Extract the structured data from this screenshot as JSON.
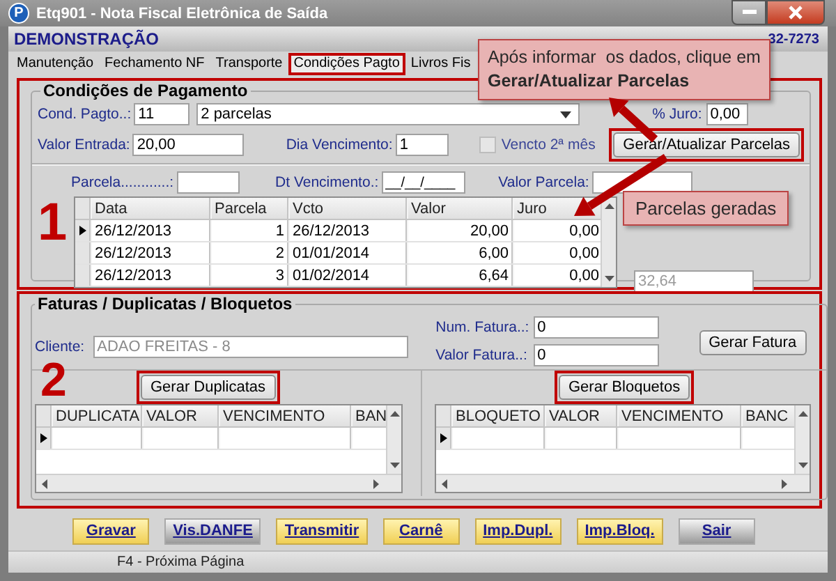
{
  "window": {
    "icon_letter": "P",
    "title": "Etq901 - Nota Fiscal Eletrônica de Saída"
  },
  "header": {
    "company": "DEMONSTRAÇÃO",
    "phone": "32-7273"
  },
  "tabs": [
    {
      "label": "Manutenção",
      "selected": false,
      "highlighted": false
    },
    {
      "label": "Fechamento NF",
      "selected": false,
      "highlighted": false
    },
    {
      "label": "Transporte",
      "selected": false,
      "highlighted": false
    },
    {
      "label": "Condições Pagto",
      "selected": true,
      "highlighted": true
    },
    {
      "label": "Livros Fis",
      "selected": false,
      "highlighted": false
    }
  ],
  "payment": {
    "highlighted": true,
    "marker": "1",
    "title": "Condições de Pagamento",
    "cond_label": "Cond. Pagto..:",
    "cond_code": "11",
    "cond_desc": "2 parcelas",
    "juro_label": "% Juro:",
    "juro": "0,00",
    "entrada_label": "Valor Entrada:",
    "entrada": "20,00",
    "dia_label": "Dia Vencimento:",
    "dia": "1",
    "vencto2": {
      "label": "Vencto 2ª mês",
      "checked": false,
      "disabled": true
    },
    "generate_button": {
      "label": "Gerar/Atualizar Parcelas",
      "highlighted": true
    },
    "parcela_label": "Parcela............:",
    "dt_label": "Dt Vencimento.:",
    "dt_value": "__/__/____",
    "valor_parcela_label": "Valor Parcela:",
    "table": {
      "columns": [
        {
          "label": "Data",
          "kind": "text"
        },
        {
          "label": "Parcela",
          "kind": "number"
        },
        {
          "label": "Vcto",
          "kind": "text"
        },
        {
          "label": "Valor",
          "kind": "number"
        },
        {
          "label": "Juro",
          "kind": "number"
        }
      ],
      "rows": [
        {
          "selected": true,
          "cells": [
            "26/12/2013",
            "1",
            "26/12/2013",
            "20,00",
            "0,00"
          ]
        },
        {
          "selected": false,
          "cells": [
            "26/12/2013",
            "2",
            "01/01/2014",
            "6,00",
            "0,00"
          ]
        },
        {
          "selected": false,
          "cells": [
            "26/12/2013",
            "3",
            "01/02/2014",
            "6,64",
            "0,00"
          ]
        }
      ]
    },
    "total": "32,64"
  },
  "invoices": {
    "highlighted": true,
    "marker": "2",
    "title": "Faturas / Duplicatas / Bloquetos",
    "cliente_label": "Cliente:",
    "cliente": "ADAO FREITAS - 8",
    "num_label": "Num. Fatura..:",
    "num": "0",
    "valor_label": "Valor Fatura..:",
    "valor": "0",
    "fatura_button": {
      "label": "Gerar Fatura"
    },
    "grids": [
      {
        "button": {
          "label": "Gerar Duplicatas",
          "highlighted": true
        },
        "columns": [
          "DUPLICATA",
          "VALOR",
          "VENCIMENTO",
          "BAN"
        ],
        "rows": [
          {
            "selected": true
          }
        ]
      },
      {
        "button": {
          "label": "Gerar Bloquetos",
          "highlighted": true
        },
        "columns": [
          "BLOQUETO",
          "VALOR",
          "VENCIMENTO",
          "BANC"
        ],
        "rows": [
          {
            "selected": true
          }
        ]
      }
    ]
  },
  "actions": [
    {
      "label": "Gravar",
      "kind": "accent"
    },
    {
      "label": "Vis.DANFE",
      "kind": "plain"
    },
    {
      "label": "Transmitir",
      "kind": "accent"
    },
    {
      "label": "Carnê",
      "kind": "accent"
    },
    {
      "label": "Imp.Dupl.",
      "kind": "accent"
    },
    {
      "label": "Imp.Bloq.",
      "kind": "accent"
    },
    {
      "label": "Sair",
      "kind": "plain"
    }
  ],
  "status_bar": "F4 - Próxima Página",
  "callouts": [
    {
      "text": "Após informar  os dados, clique em **Gerar/Atualizar Parcelas**"
    },
    {
      "text": "Parcelas geradas"
    }
  ]
}
